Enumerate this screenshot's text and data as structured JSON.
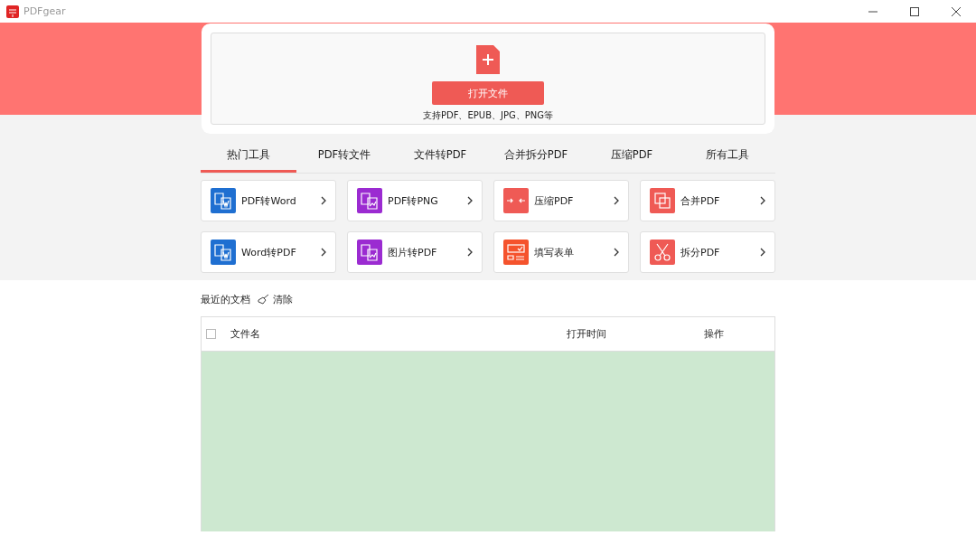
{
  "window": {
    "title": "PDFgear"
  },
  "upload": {
    "button": "打开文件",
    "hint": "支持PDF、EPUB、JPG、PNG等"
  },
  "tabs": [
    {
      "label": "热门工具",
      "selected": true
    },
    {
      "label": "PDF转文件",
      "selected": false
    },
    {
      "label": "文件转PDF",
      "selected": false
    },
    {
      "label": "合并拆分PDF",
      "selected": false
    },
    {
      "label": "压缩PDF",
      "selected": false
    },
    {
      "label": "所有工具",
      "selected": false
    }
  ],
  "tools": [
    {
      "label": "PDF转Word",
      "kind": "convert",
      "color": "#1f6fd1"
    },
    {
      "label": "PDF转PNG",
      "kind": "image",
      "color": "#9b2bd1"
    },
    {
      "label": "压缩PDF",
      "kind": "compress",
      "color": "#ef5a55"
    },
    {
      "label": "合并PDF",
      "kind": "merge",
      "color": "#ef5a55"
    },
    {
      "label": "Word转PDF",
      "kind": "convert",
      "color": "#1f6fd1"
    },
    {
      "label": "图片转PDF",
      "kind": "image",
      "color": "#9b2bd1"
    },
    {
      "label": "填写表单",
      "kind": "form",
      "color": "#f5532d"
    },
    {
      "label": "拆分PDF",
      "kind": "split",
      "color": "#ef5a55"
    }
  ],
  "recent": {
    "title": "最近的文档",
    "clear": "清除"
  },
  "table": {
    "checked": false,
    "columns": [
      "文件名",
      "打开时间",
      "操作"
    ]
  }
}
